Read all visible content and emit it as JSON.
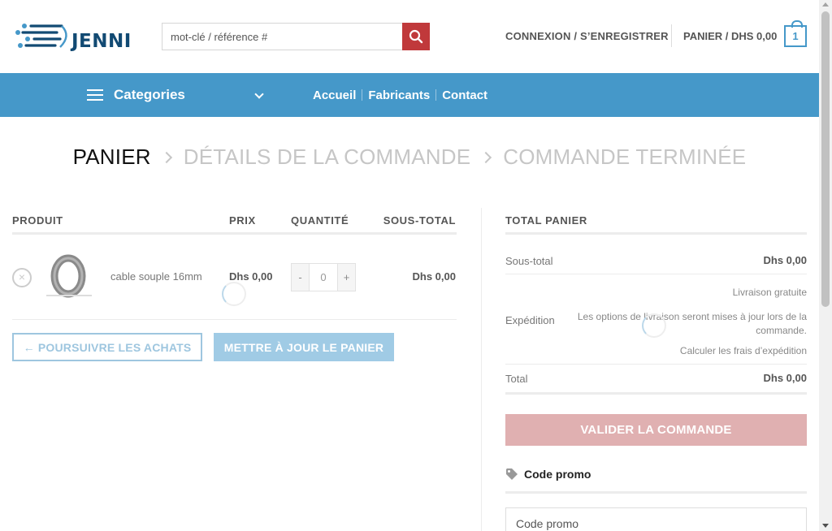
{
  "header": {
    "logo_text": "JENNI",
    "search_placeholder": "mot-clé / référence #",
    "login_label": "CONNEXION / S’ENREGISTRER",
    "cart_label": "PANIER / DHS 0,00",
    "cart_count": "1"
  },
  "nav": {
    "categories_label": "Categories",
    "links": [
      "Accueil",
      "Fabricants",
      "Contact"
    ]
  },
  "steps": [
    "PANIER",
    "DÉTAILS DE LA COMMANDE",
    "COMMANDE TERMINÉE"
  ],
  "cart": {
    "headers": {
      "product": "PRODUIT",
      "price": "PRIX",
      "quantity": "QUANTITÉ",
      "subtotal": "SOUS-TOTAL"
    },
    "items": [
      {
        "name": "cable souple 16mm",
        "price": "Dhs 0,00",
        "quantity": "0",
        "subtotal": "Dhs 0,00"
      }
    ],
    "remove_glyph": "×",
    "qty_minus": "-",
    "qty_plus": "+",
    "continue_label": "← POURSUIVRE LES ACHATS",
    "update_label": "METTRE À JOUR LE PANIER"
  },
  "totals": {
    "title": "TOTAL PANIER",
    "subtotal_label": "Sous-total",
    "subtotal_value": "Dhs 0,00",
    "shipping_label": "Expédition",
    "shipping_free": "Livraison gratuite",
    "shipping_note": "Les options de livraison seront mises à jour lors de la commande.",
    "shipping_calc": "Calculer les frais d’expédition",
    "total_label": "Total",
    "total_value": "Dhs 0,00",
    "checkout_label": "VALIDER LA COMMANDE",
    "promo_title": "Code promo",
    "promo_placeholder": "Code promo"
  },
  "colors": {
    "brand_blue": "#4598c9",
    "logo_navy": "#124a73",
    "search_red": "#c0393b",
    "checkout_pink": "#e0b0b1"
  }
}
